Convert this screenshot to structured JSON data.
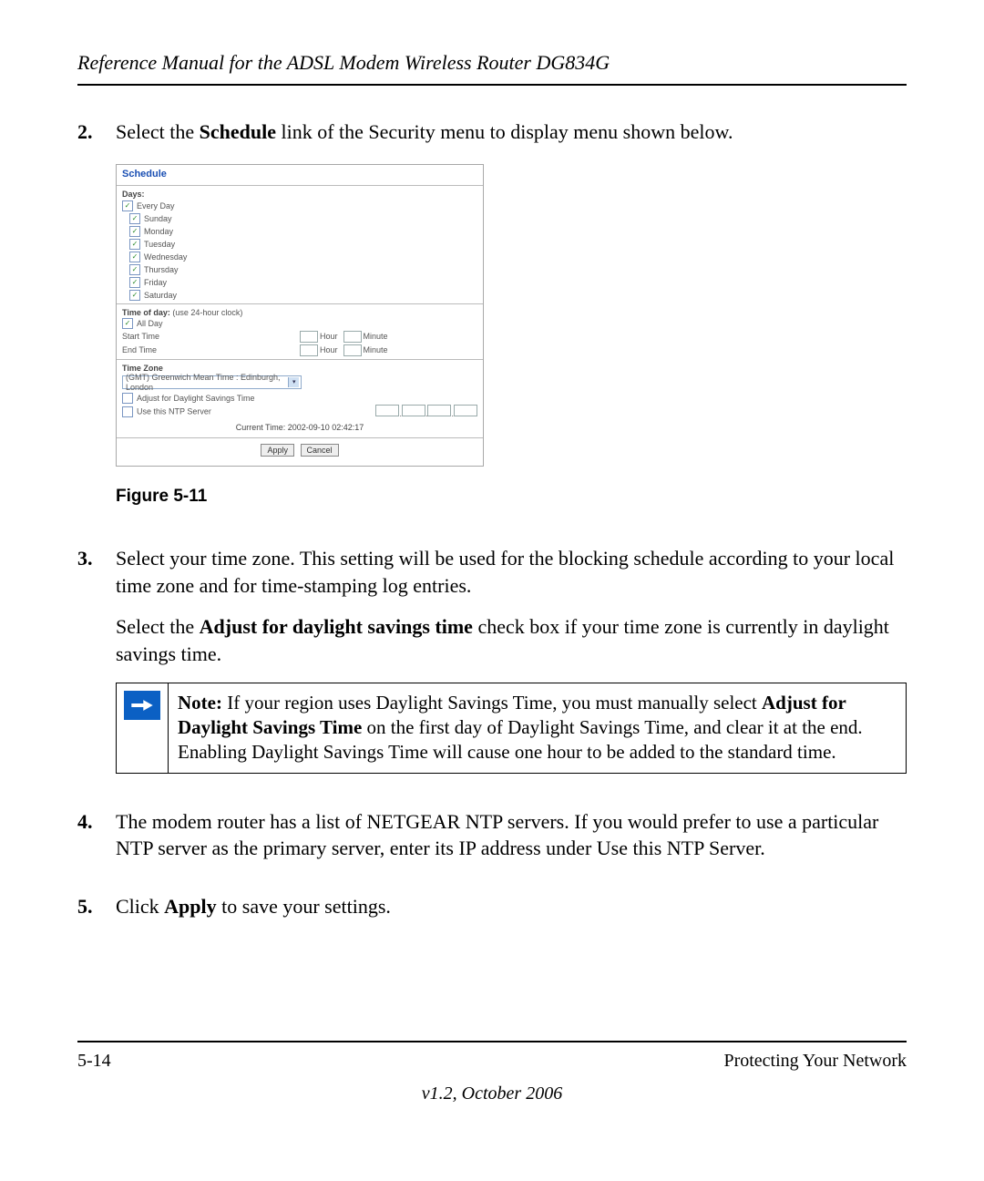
{
  "header": {
    "title": "Reference Manual for the ADSL Modem Wireless Router DG834G"
  },
  "steps": {
    "s2": {
      "num": "2.",
      "pre": "Select the ",
      "link": "Schedule",
      "post": " link of the Security menu to display menu shown below."
    },
    "s3": {
      "num": "3.",
      "p1": "Select your time zone. This setting will be used for the blocking schedule according to your local time zone and for time-stamping log entries.",
      "p2a": "Select the ",
      "p2b": "Adjust for daylight savings time",
      "p2c": " check box if your time zone is currently in daylight savings time."
    },
    "s4": {
      "num": "4.",
      "text": "The modem router has a list of NETGEAR NTP servers. If you would prefer to use a particular NTP server as the primary server, enter its IP address under Use this NTP Server."
    },
    "s5": {
      "num": "5.",
      "pre": "Click ",
      "bold": "Apply",
      "post": " to save your settings."
    }
  },
  "figure_caption": "Figure 5-11",
  "shot": {
    "title": "Schedule",
    "days_label": "Days:",
    "days": [
      "Every Day",
      "Sunday",
      "Monday",
      "Tuesday",
      "Wednesday",
      "Thursday",
      "Friday",
      "Saturday"
    ],
    "days_checked": [
      true,
      true,
      true,
      true,
      true,
      true,
      true,
      true
    ],
    "tod_label": "Time of day:",
    "tod_note": " (use 24-hour clock)",
    "allday": "All Day",
    "start": "Start Time",
    "end": "End Time",
    "hour": "Hour",
    "minute": "Minute",
    "tz_label": "Time Zone",
    "tz_value": "(GMT) Greenwich Mean Time : Edinburgh, London",
    "dst": "Adjust for Daylight Savings Time",
    "ntp": "Use this NTP Server",
    "current": "Current Time:  2002-09-10 02:42:17",
    "apply": "Apply",
    "cancel": "Cancel",
    "ip_sep": "."
  },
  "note": {
    "lead": "Note:",
    "t1": " If your region uses Daylight Savings Time, you must manually select ",
    "b1": "Adjust for Daylight Savings Time",
    "t2": " on the first day of Daylight Savings Time, and clear it at the end. Enabling Daylight Savings Time will cause one hour to be added to the standard time."
  },
  "footer": {
    "left": "5-14",
    "right": "Protecting Your Network",
    "version": "v1.2, October 2006"
  }
}
